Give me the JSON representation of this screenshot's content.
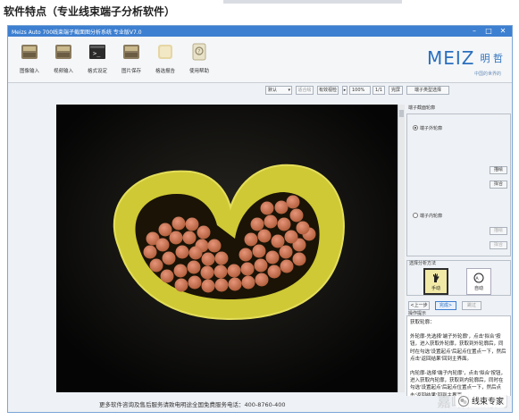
{
  "page": {
    "heading": "软件特点（专业线束端子分析软件）"
  },
  "window": {
    "title": "Meizs Auto 700线束端子截面图分析系统 专业版V7.0",
    "minimize_glyph": "–",
    "maximize_glyph": "□",
    "close_glyph": "✕"
  },
  "toolbar": {
    "items": [
      {
        "label": "图像输入",
        "icon": "image-input-icon"
      },
      {
        "label": "视频输入",
        "icon": "video-input-icon"
      },
      {
        "label": "格式设定",
        "icon": "format-settings-icon"
      },
      {
        "label": "图片保存",
        "icon": "save-image-icon"
      },
      {
        "label": "格选报告",
        "icon": "report-icon"
      },
      {
        "label": "使用帮助",
        "icon": "help-icon"
      }
    ]
  },
  "logo": {
    "brand": "MEIZ",
    "cn": "明 哲",
    "sub": "中国的世界的"
  },
  "controls": {
    "preset_select": "默认",
    "btn_fit": "适合绘",
    "btn_view": "有效视检",
    "zoom_value": "100%",
    "page_indicator": "1/1",
    "btn_fullscreen": "完屏",
    "btn_terminal_type": "端子类型选择"
  },
  "right_panel": {
    "section_title": "端子截面轮廓",
    "outer_contour_label": "端子外轮廓",
    "btn_draw_1": "描绘",
    "btn_fit_1": "拟合",
    "inner_contour_label": "端子内轮廓",
    "btn_draw_2": "描绘",
    "btn_fit_2": "拟合",
    "analysis_mode_title": "选择分析方法",
    "mode_manual": "手动",
    "mode_auto": "自动",
    "btn_prev": "<上一步",
    "btn_done": "完成>",
    "btn_skip": "跳过",
    "help_title": "操作提示",
    "help_paragraphs": [
      "获取轮廓：",
      "外轮廓-先选择'端子外轮廓'，点击'拟合'按钮，进入获取外轮廓，获取到外轮廓后，同时在勾选'设置起点'后起点位置点一下，然后点击'返回结果'回到主界面。",
      "内轮廓-选择'端子内轮廓'，点击'拟合'按钮，进入获取内轮廓，获取到内轮廓后，同时在勾选'设置起点'后起点位置点一下，然后点击'返回结果'回到主界面。"
    ]
  },
  "status": {
    "text": "更多软件咨询及售后服务请致电明途全国免费服务电话：400-8760-400"
  },
  "overlay": {
    "watermark": "嘉峪检测网",
    "wechat_name": "线束专家"
  },
  "colors": {
    "titlebar": "#3d7fd0",
    "accent": "#2a6fbf",
    "terminal_yellow": "#d7d236",
    "strand_copper": "#c8704a"
  }
}
